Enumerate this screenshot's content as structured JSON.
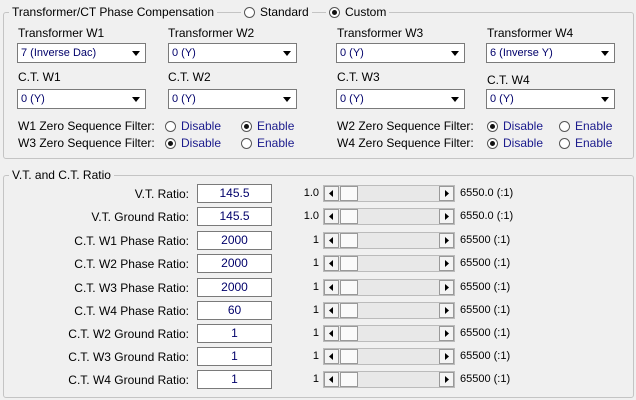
{
  "compensation": {
    "title": "Transformer/CT Phase Compensation",
    "mode_standard": "Standard",
    "mode_custom": "Custom",
    "selected_mode": "Custom",
    "transformers": [
      {
        "label": "Transformer  W1",
        "value": "7 (Inverse Dac)"
      },
      {
        "label": "Transformer W2",
        "value": "0 (Y)"
      },
      {
        "label": "Transformer W3",
        "value": "0 (Y)"
      },
      {
        "label": "Transformer W4",
        "value": "6 (Inverse Y)"
      }
    ],
    "cts": [
      {
        "label": "C.T. W1",
        "value": "0 (Y)"
      },
      {
        "label": "C.T. W2",
        "value": "0 (Y)"
      },
      {
        "label": "C.T. W3",
        "value": "0 (Y)"
      },
      {
        "label": "C.T. W4",
        "value": "0 (Y)"
      }
    ],
    "filters": [
      {
        "label": "W1 Zero Sequence Filter:",
        "selected": "Enable"
      },
      {
        "label": "W3 Zero Sequence Filter:",
        "selected": "Disable"
      },
      {
        "label": "W2 Zero Sequence Filter:",
        "selected": "Disable"
      },
      {
        "label": "W4 Zero Sequence Filter:",
        "selected": "Disable"
      }
    ],
    "disable_label": "Disable",
    "enable_label": "Enable"
  },
  "ratios": {
    "title": "V.T. and C.T. Ratio",
    "rows": [
      {
        "label": "V.T. Ratio:",
        "value": "145.5",
        "min": "1.0",
        "max": "6550.0 (:1)"
      },
      {
        "label": "V.T. Ground Ratio:",
        "value": "145.5",
        "min": "1.0",
        "max": "6550.0 (:1)"
      },
      {
        "label": "C.T. W1 Phase Ratio:",
        "value": "2000",
        "min": "1",
        "max": "65500 (:1)"
      },
      {
        "label": "C.T. W2 Phase Ratio:",
        "value": "2000",
        "min": "1",
        "max": "65500 (:1)"
      },
      {
        "label": "C.T. W3 Phase Ratio:",
        "value": "2000",
        "min": "1",
        "max": "65500 (:1)"
      },
      {
        "label": "C.T. W4 Phase Ratio:",
        "value": "60",
        "min": "1",
        "max": "65500 (:1)"
      },
      {
        "label": "C.T. W2 Ground Ratio:",
        "value": "1",
        "min": "1",
        "max": "65500 (:1)"
      },
      {
        "label": "C.T. W3 Ground Ratio:",
        "value": "1",
        "min": "1",
        "max": "65500 (:1)"
      },
      {
        "label": "C.T. W4 Ground Ratio:",
        "value": "1",
        "min": "1",
        "max": "65500 (:1)"
      }
    ]
  },
  "icons": {
    "dropdown": "chevron-down-icon",
    "scroll_left": "arrow-left-icon",
    "scroll_right": "arrow-right-icon"
  }
}
